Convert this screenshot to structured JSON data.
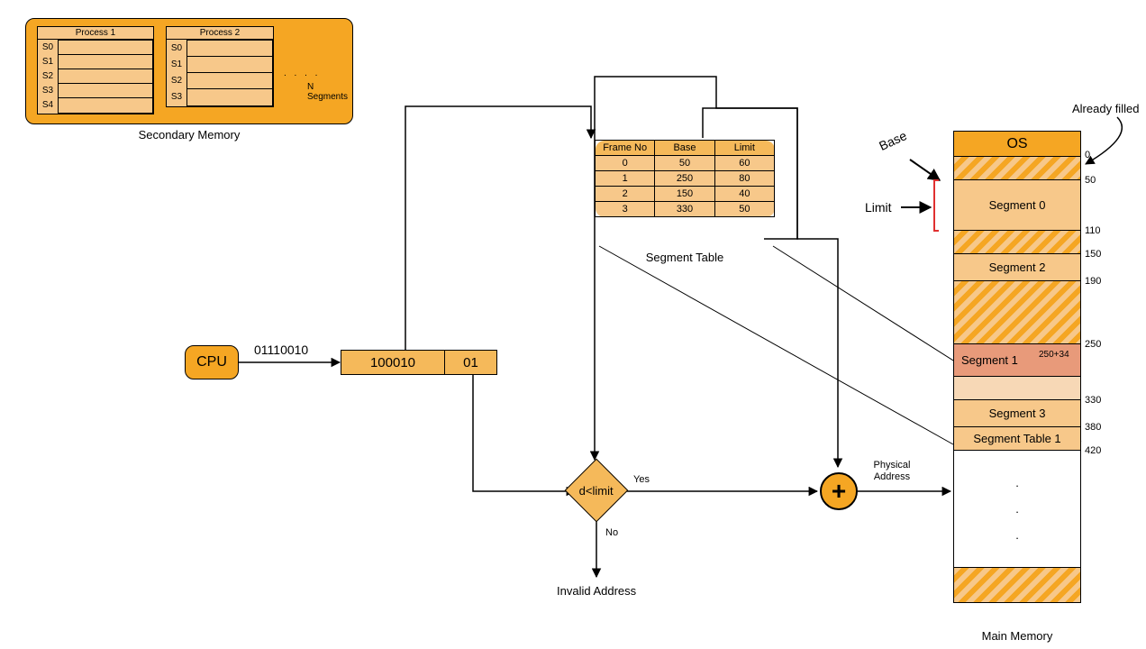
{
  "secondary_memory": {
    "title": "Secondary Memory",
    "process1": {
      "title": "Process 1",
      "rows": [
        "S0",
        "S1",
        "S2",
        "S3",
        "S4"
      ]
    },
    "process2": {
      "title": "Process 2",
      "rows": [
        "S0",
        "S1",
        "S2",
        "S3"
      ]
    },
    "n_segments": "N Segments",
    "dots": ". . . ."
  },
  "cpu": {
    "label": "CPU",
    "bits": "01110010"
  },
  "logical_address": {
    "left": "100010",
    "right": "01"
  },
  "segment_table": {
    "title": "Segment Table",
    "headers": [
      "Frame No",
      "Base",
      "Limit"
    ],
    "rows": [
      [
        "0",
        "50",
        "60"
      ],
      [
        "1",
        "250",
        "80"
      ],
      [
        "2",
        "150",
        "40"
      ],
      [
        "3",
        "330",
        "50"
      ]
    ]
  },
  "decision": {
    "cond": "d<limit",
    "yes": "Yes",
    "no": "No",
    "invalid": "Invalid Address"
  },
  "adder": {
    "label": "Physical Address",
    "plus": "+"
  },
  "main_memory": {
    "title": "Main Memory",
    "already_filled": "Already filled",
    "base_label": "Base",
    "limit_label": "Limit",
    "os": "OS",
    "segments": {
      "seg0": "Segment 0",
      "seg2": "Segment 2",
      "seg1": "Segment 1",
      "seg1_offset": "250+34",
      "seg3": "Segment 3",
      "segtable1": "Segment Table 1"
    },
    "addresses": [
      "0",
      "50",
      "110",
      "150",
      "190",
      "250",
      "330",
      "380",
      "420"
    ]
  }
}
